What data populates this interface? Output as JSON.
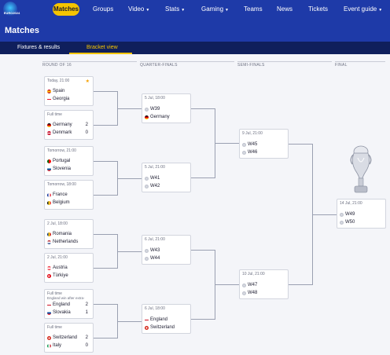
{
  "nav": {
    "logo_text": "EURO2024",
    "active": "Matches",
    "items": [
      "Groups",
      "Video",
      "Stats",
      "Gaming",
      "Teams",
      "News",
      "Tickets",
      "Event guide"
    ],
    "dropdowns": [
      false,
      true,
      true,
      true,
      false,
      false,
      false,
      true
    ]
  },
  "page_title": "Matches",
  "tabs": [
    "Fixtures & results",
    "Bracket view"
  ],
  "active_tab": "Bracket view",
  "rounds": [
    "ROUND OF 16",
    "QUARTER-FINALS",
    "SEMI-FINALS",
    "FINAL"
  ],
  "r16": [
    {
      "meta": "Today, 21:00",
      "star": true,
      "teams": [
        {
          "name": "Spain",
          "flag": "spain"
        },
        {
          "name": "Georgia",
          "flag": "georgia"
        }
      ],
      "scores": [
        "",
        ""
      ]
    },
    {
      "meta": "Full time",
      "teams": [
        {
          "name": "Germany",
          "flag": "germany"
        },
        {
          "name": "Denmark",
          "flag": "denmark"
        }
      ],
      "scores": [
        "2",
        "0"
      ]
    },
    {
      "meta": "Tomorrow, 21:00",
      "teams": [
        {
          "name": "Portugal",
          "flag": "portugal"
        },
        {
          "name": "Slovenia",
          "flag": "slovenia"
        }
      ],
      "scores": [
        "",
        ""
      ]
    },
    {
      "meta": "Tomorrow, 18:00",
      "teams": [
        {
          "name": "France",
          "flag": "france"
        },
        {
          "name": "Belgium",
          "flag": "belgium"
        }
      ],
      "scores": [
        "",
        ""
      ]
    },
    {
      "meta": "2 Jul, 18:00",
      "teams": [
        {
          "name": "Romania",
          "flag": "romania"
        },
        {
          "name": "Netherlands",
          "flag": "netherlands"
        }
      ],
      "scores": [
        "",
        ""
      ]
    },
    {
      "meta": "2 Jul, 21:00",
      "teams": [
        {
          "name": "Austria",
          "flag": "austria"
        },
        {
          "name": "Türkiye",
          "flag": "turkiye"
        }
      ],
      "scores": [
        "",
        ""
      ]
    },
    {
      "meta": "Full time",
      "meta2": "England win after extra-",
      "teams": [
        {
          "name": "England",
          "flag": "england"
        },
        {
          "name": "Slovakia",
          "flag": "slovakia"
        }
      ],
      "scores": [
        "2",
        "1"
      ]
    },
    {
      "meta": "Full time",
      "teams": [
        {
          "name": "Switzerland",
          "flag": "switzerland"
        },
        {
          "name": "Italy",
          "flag": "italy"
        }
      ],
      "scores": [
        "2",
        "0"
      ]
    }
  ],
  "qf": [
    {
      "meta": "5 Jul, 18:00",
      "teams": [
        {
          "name": "W39",
          "flag": "tbd"
        },
        {
          "name": "Germany",
          "flag": "germany"
        }
      ]
    },
    {
      "meta": "5 Jul, 21:00",
      "teams": [
        {
          "name": "W41",
          "flag": "tbd"
        },
        {
          "name": "W42",
          "flag": "tbd"
        }
      ]
    },
    {
      "meta": "6 Jul, 21:00",
      "teams": [
        {
          "name": "W43",
          "flag": "tbd"
        },
        {
          "name": "W44",
          "flag": "tbd"
        }
      ]
    },
    {
      "meta": "6 Jul, 18:00",
      "teams": [
        {
          "name": "England",
          "flag": "england"
        },
        {
          "name": "Switzerland",
          "flag": "switzerland"
        }
      ]
    }
  ],
  "sf": [
    {
      "meta": "9 Jul, 21:00",
      "teams": [
        {
          "name": "W45",
          "flag": "tbd"
        },
        {
          "name": "W46",
          "flag": "tbd"
        }
      ]
    },
    {
      "meta": "10 Jul, 21:00",
      "teams": [
        {
          "name": "W47",
          "flag": "tbd"
        },
        {
          "name": "W48",
          "flag": "tbd"
        }
      ]
    }
  ],
  "final": {
    "meta": "14 Jul, 21:00",
    "teams": [
      {
        "name": "W49",
        "flag": "tbd"
      },
      {
        "name": "W50",
        "flag": "tbd"
      }
    ]
  },
  "colors": {
    "nav": "#1e3aa8",
    "tabs": "#0f1f5c",
    "accent": "#f5c400"
  }
}
